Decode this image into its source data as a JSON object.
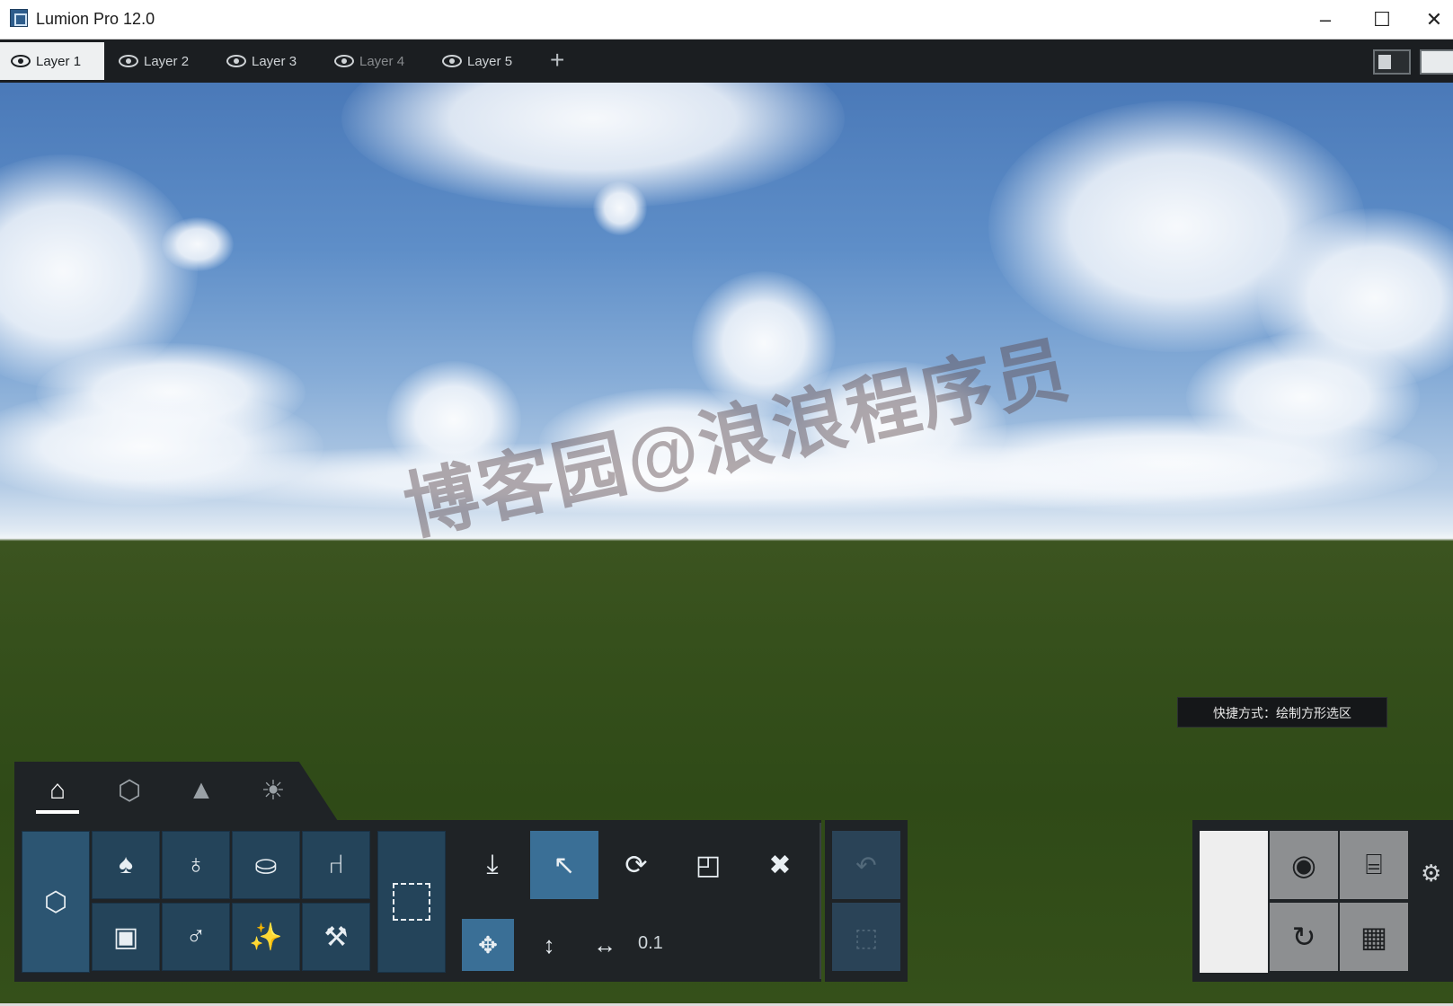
{
  "window": {
    "title": "Lumion Pro 12.0",
    "minimize_glyph": "–",
    "maximize_glyph": "☐",
    "close_glyph": "✕"
  },
  "layers": {
    "tabs": [
      {
        "label": "Layer 1",
        "active": true
      },
      {
        "label": "Layer 2",
        "active": false
      },
      {
        "label": "Layer 3",
        "active": false
      },
      {
        "label": "Layer 4",
        "active": false
      },
      {
        "label": "Layer 5",
        "active": false
      }
    ],
    "add_glyph": "+"
  },
  "viewport": {
    "watermark": "博客园@浪浪程序员",
    "shortcut_tooltip": "快捷方式：绘制方形选区"
  },
  "mode_tabs": [
    {
      "icon": "home-icon",
      "glyph": "⌂",
      "active": true
    },
    {
      "icon": "material-icon",
      "glyph": "⬡",
      "active": false
    },
    {
      "icon": "landscape-icon",
      "glyph": "▲",
      "active": false
    },
    {
      "icon": "weather-icon",
      "glyph": "☀",
      "active": false
    }
  ],
  "object_tools": [
    {
      "icon": "tree-icon",
      "glyph": "♠"
    },
    {
      "icon": "person-icon",
      "glyph": "♁"
    },
    {
      "icon": "car-icon",
      "glyph": "⛀"
    },
    {
      "icon": "chair-icon",
      "glyph": "⑁"
    },
    {
      "icon": "effects-icon",
      "glyph": "▣"
    },
    {
      "icon": "light-bulb-icon",
      "glyph": "♂"
    },
    {
      "icon": "magic-wand-icon",
      "glyph": "✨"
    },
    {
      "icon": "utility-wrench-icon",
      "glyph": "⚒"
    }
  ],
  "edit_tools": {
    "place": "⤓",
    "select": "↖",
    "rotate": "⟳",
    "scale": "◰",
    "delete": "✖",
    "move": "✥",
    "height": "↕",
    "slide": "↔",
    "value": "0.1"
  },
  "history": {
    "undo": "↶",
    "deselect": "⬚"
  },
  "output": {
    "photo_glyph": "◉",
    "movie_glyph": "⌸",
    "panorama_glyph": "↻",
    "export_glyph": "▦",
    "settings_glyph": "⚙"
  }
}
